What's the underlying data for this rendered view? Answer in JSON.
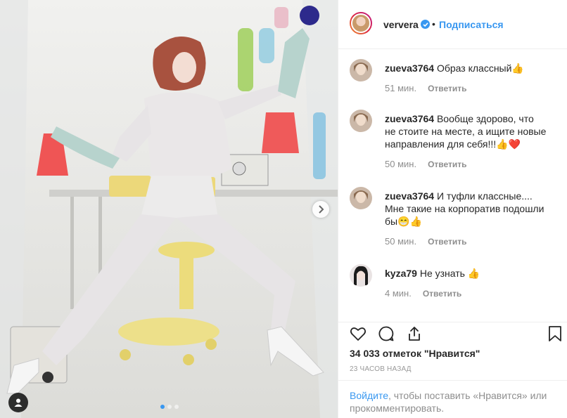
{
  "post": {
    "author": "ververa",
    "follow_label": "Подписаться",
    "separator": "•",
    "likes_text": "34 033 отметок \"Нравится\"",
    "timestamp": "23 ЧАСОВ НАЗАД",
    "carousel_count": 3,
    "carousel_active": 0
  },
  "comments": [
    {
      "user": "zueva3764",
      "text": "Образ классный👍",
      "time": "51 мин.",
      "reply_label": "Ответить",
      "avatar": "woman-portrait"
    },
    {
      "user": "zueva3764",
      "text": "Вообще здорово, что не стоите на месте, а ищите новые направления для себя!!!👍❤️",
      "time": "50 мин.",
      "reply_label": "Ответить",
      "avatar": "woman-portrait"
    },
    {
      "user": "zueva3764",
      "text": "И туфли классные.... Мне такие на корпоратив подошли бы😁👍",
      "time": "50 мин.",
      "reply_label": "Ответить",
      "avatar": "woman-portrait"
    },
    {
      "user": "kyza79",
      "text": "Не узнать 👍",
      "time": "4 мин.",
      "reply_label": "Ответить",
      "avatar": "dark-hair-woman"
    }
  ],
  "login_prompt": {
    "link": "Войдите",
    "rest": ", чтобы поставить «Нравится» или прокомментировать."
  },
  "icons": {
    "like": "heart-icon",
    "comment": "comment-icon",
    "share": "share-icon",
    "save": "bookmark-icon",
    "next": "chevron-right-icon",
    "tag": "user-tag-icon",
    "verified": "verified-badge-icon"
  },
  "colors": {
    "link": "#3897f0",
    "text": "#262626",
    "muted": "#8e8e8e"
  }
}
